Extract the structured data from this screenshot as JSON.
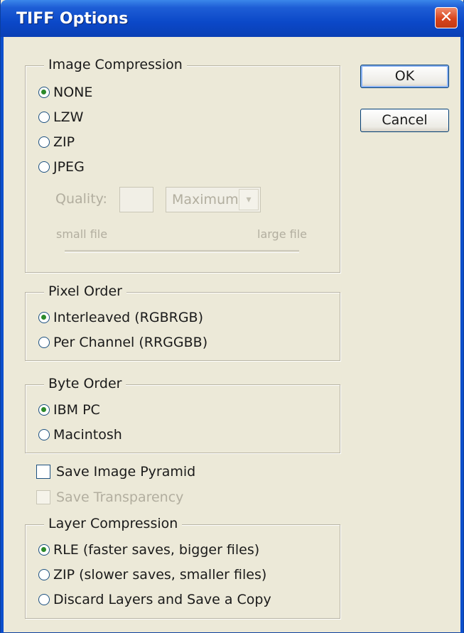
{
  "window": {
    "title": "TIFF Options",
    "close_symbol": "✕"
  },
  "buttons": {
    "ok": "OK",
    "cancel": "Cancel"
  },
  "image_compression": {
    "label": "Image Compression",
    "options": [
      "NONE",
      "LZW",
      "ZIP",
      "JPEG"
    ],
    "selected": "NONE",
    "quality_label": "Quality:",
    "quality_value": "",
    "quality_preset": "Maximum",
    "slider_left": "small file",
    "slider_right": "large file"
  },
  "pixel_order": {
    "label": "Pixel Order",
    "options": [
      "Interleaved (RGBRGB)",
      "Per Channel (RRGGBB)"
    ],
    "selected": "Interleaved (RGBRGB)"
  },
  "byte_order": {
    "label": "Byte Order",
    "options": [
      "IBM PC",
      "Macintosh"
    ],
    "selected": "IBM PC"
  },
  "checkboxes": {
    "save_pyramid": {
      "label": "Save Image Pyramid",
      "checked": false
    },
    "save_transparency": {
      "label": "Save Transparency",
      "checked": false,
      "disabled": true
    }
  },
  "layer_compression": {
    "label": "Layer Compression",
    "options": [
      "RLE (faster saves, bigger files)",
      "ZIP (slower saves, smaller files)",
      "Discard Layers and Save a Copy"
    ],
    "selected": "RLE (faster saves, bigger files)"
  },
  "icons": {
    "radio_on": "radio-selected-icon",
    "radio_off": "radio-unselected-icon",
    "checkbox": "checkbox-icon",
    "dropdown": "chevron-down-icon",
    "close": "close-icon"
  },
  "colors": {
    "titlebar": "#0b48c8",
    "dialog_bg": "#ece9d8",
    "close_button": "#d8441c",
    "radio_dot": "#2b8a2b"
  }
}
